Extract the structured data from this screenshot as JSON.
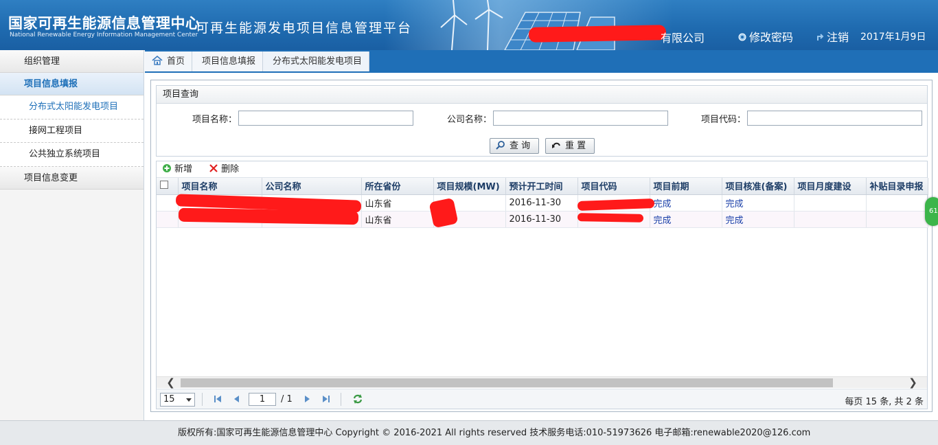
{
  "header": {
    "org_name_cn": "国家可再生能源信息管理中心",
    "org_name_en": "National Renewable Energy  Information Management Center",
    "platform_title": "可再生能源发电项目信息管理平台",
    "company_suffix": "有限公司",
    "change_password": "修改密码",
    "logout": "注销",
    "date": "2017年1月9日"
  },
  "sidebar": {
    "groups": [
      {
        "label": "组织管理"
      },
      {
        "label": "项目信息填报",
        "items": [
          "分布式太阳能发电项目",
          "接网工程项目",
          "公共独立系统项目"
        ]
      },
      {
        "label": "项目信息变更"
      }
    ]
  },
  "breadcrumb": [
    "首页",
    "项目信息填报",
    "分布式太阳能发电项目"
  ],
  "query": {
    "title": "项目查询",
    "fields": [
      {
        "label": "项目名称：",
        "value": ""
      },
      {
        "label": "公司名称：",
        "value": ""
      },
      {
        "label": "项目代码：",
        "value": ""
      }
    ],
    "search_label": "查 询",
    "reset_label": "重 置"
  },
  "toolbar": {
    "add_label": "新增",
    "delete_label": "删除"
  },
  "grid": {
    "columns": [
      "项目名称",
      "公司名称",
      "所在省份",
      "项目规模(MW)",
      "预计开工时间",
      "项目代码",
      "项目前期",
      "项目核准(备案)",
      "项目月度建设",
      "补贴目录申报"
    ],
    "rows": [
      {
        "name": "",
        "company": "",
        "province": "山东省",
        "scale": "",
        "start": "2016-11-30",
        "code": "",
        "pre": "完成",
        "approval": "完成",
        "monthly": "",
        "subsidy": ""
      },
      {
        "name": "",
        "company": "",
        "province": "山东省",
        "scale": "",
        "start": "2016-11-30",
        "code": "",
        "pre": "完成",
        "approval": "完成",
        "monthly": "",
        "subsidy": ""
      }
    ]
  },
  "pager": {
    "page_size": "15",
    "current_page": "1",
    "total_pages": "/ 1",
    "summary": "每页 15 条, 共 2 条"
  },
  "side_badge": "61",
  "footer": {
    "text": "版权所有:国家可再生能源信息管理中心    Copyright © 2016-2021 All rights reserved    技术服务电话:010-51973626    电子邮箱:renewable2020@126.com"
  },
  "colors": {
    "header_blue": "#1f6bb0",
    "breadcrumb_blue": "#1f6fb7",
    "active_text": "#1d6fb8",
    "redaction": "#ff1a1a",
    "link_blue": "#1a3fa8"
  }
}
